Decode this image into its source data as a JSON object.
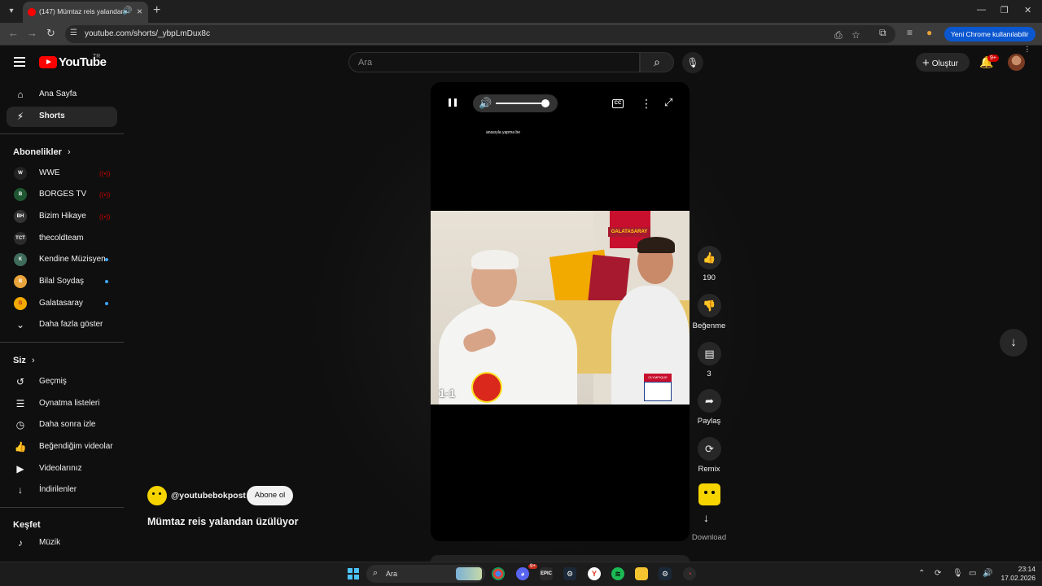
{
  "browser": {
    "tab_title": "(147) Mümtaz reis yalandan üzülüyor",
    "url": "youtube.com/shorts/_ybpLmDux8c",
    "profile_label": "Yeni Chrome kullanılabilir"
  },
  "header": {
    "logo_text": "YouTube",
    "country": "TR",
    "search_placeholder": "Ara",
    "create_label": "Oluştur",
    "notifications_badge": "9+"
  },
  "sidebar": {
    "main": [
      {
        "label": "Ana Sayfa",
        "icon": "home-icon"
      },
      {
        "label": "Shorts",
        "icon": "shorts-icon",
        "active": true
      }
    ],
    "subscriptions_heading": "Abonelikler",
    "subscriptions": [
      {
        "label": "WWE",
        "status": "live",
        "avatar_color": "#222222",
        "avatar_text": "W"
      },
      {
        "label": "BORGES TV",
        "status": "live",
        "avatar_color": "#1e5631",
        "avatar_text": "B"
      },
      {
        "label": "Bizim Hikaye",
        "status": "live",
        "avatar_color": "#333333",
        "avatar_text": "BH"
      },
      {
        "label": "thecoldteam",
        "status": "none",
        "avatar_color": "#2b2b2b",
        "avatar_text": "TCT"
      },
      {
        "label": "Kendine Müzisyen",
        "status": "new",
        "avatar_color": "#3f6b5a",
        "avatar_text": "K"
      },
      {
        "label": "Bilal Soydaş",
        "status": "new",
        "avatar_color": "#e8a33a",
        "avatar_text": "B"
      },
      {
        "label": "Galatasaray",
        "status": "new",
        "avatar_color": "#f2a900",
        "avatar_text": "G"
      }
    ],
    "show_more": "Daha fazla göster",
    "you_heading": "Siz",
    "you_items": [
      {
        "label": "Geçmiş",
        "icon": "history-icon"
      },
      {
        "label": "Oynatma listeleri",
        "icon": "playlists-icon"
      },
      {
        "label": "Daha sonra izle",
        "icon": "watch-later-icon"
      },
      {
        "label": "Beğendiğim videolar",
        "icon": "liked-videos-icon"
      },
      {
        "label": "Videolarınız",
        "icon": "your-videos-icon"
      },
      {
        "label": "İndirilenler",
        "icon": "downloads-icon"
      }
    ],
    "explore_heading": "Keşfet",
    "explore_items": [
      {
        "label": "Müzik",
        "icon": "music-icon"
      }
    ]
  },
  "player": {
    "overlay_text": "anasıyla yapma be",
    "volume_level": 0.95,
    "video_frame": {
      "score": "1-1",
      "banner": "GALATASARAY",
      "team_badge": "OLYMPIQUE LYONNAIS"
    }
  },
  "actions": {
    "like_count": "190",
    "dislike_label": "Beğenme",
    "comment_count": "3",
    "share_label": "Paylaş",
    "remix_label": "Remix",
    "download_label": "Download"
  },
  "video": {
    "channel": "@youtubebokpost",
    "subscribe_label": "Abone ol",
    "title": "Mümtaz reis yalandan üzülüyor"
  },
  "taskbar": {
    "search_label": "Ara",
    "discord_badge": "9+",
    "time": "23:14",
    "date": "17.02.2026"
  }
}
